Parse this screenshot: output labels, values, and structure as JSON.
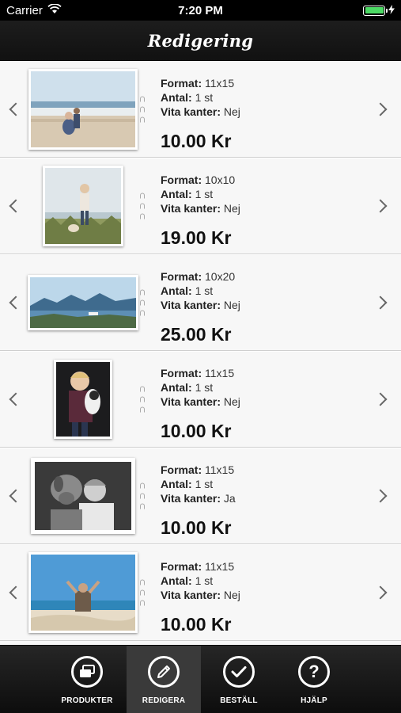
{
  "status_bar": {
    "carrier": "Carrier",
    "time": "7:20 PM",
    "battery_level": 1.0
  },
  "nav": {
    "title": "Redigering"
  },
  "items": [
    {
      "format_label": "Format:",
      "format": "11x15",
      "antal_label": "Antal:",
      "antal": "1 st",
      "kanter_label": "Vita kanter:",
      "kanter": "Nej",
      "price": "10.00 Kr",
      "photo_icon": "beach-photo"
    },
    {
      "format_label": "Format:",
      "format": "10x10",
      "antal_label": "Antal:",
      "antal": "1 st",
      "kanter_label": "Vita kanter:",
      "kanter": "Nej",
      "price": "19.00 Kr",
      "photo_icon": "woman-dog-dunes-photo"
    },
    {
      "format_label": "Format:",
      "format": "10x20",
      "antal_label": "Antal:",
      "antal": "1 st",
      "kanter_label": "Vita kanter:",
      "kanter": "Nej",
      "price": "25.00 Kr",
      "photo_icon": "mountain-lake-photo"
    },
    {
      "format_label": "Format:",
      "format": "11x15",
      "antal_label": "Antal:",
      "antal": "1 st",
      "kanter_label": "Vita kanter:",
      "kanter": "Nej",
      "price": "10.00 Kr",
      "photo_icon": "child-with-cat-photo"
    },
    {
      "format_label": "Format:",
      "format": "11x15",
      "antal_label": "Antal:",
      "antal": "1 st",
      "kanter_label": "Vita kanter:",
      "kanter": "Ja",
      "price": "10.00 Kr",
      "photo_icon": "bw-girl-dog-photo"
    },
    {
      "format_label": "Format:",
      "format": "11x15",
      "antal_label": "Antal:",
      "antal": "1 st",
      "kanter_label": "Vita kanter:",
      "kanter": "Nej",
      "price": "10.00 Kr",
      "photo_icon": "beach-arms-up-photo"
    }
  ],
  "tabs": [
    {
      "label": "PRODUKTER",
      "icon": "products-icon"
    },
    {
      "label": "REDIGERA",
      "icon": "pencil-icon",
      "active": true
    },
    {
      "label": "BESTÄLL",
      "icon": "checkmark-icon"
    },
    {
      "label": "HJÄLP",
      "icon": "question-icon"
    }
  ],
  "colors": {
    "background": "#f7f7f7",
    "bar": "#111111",
    "battery": "#4cd964"
  }
}
